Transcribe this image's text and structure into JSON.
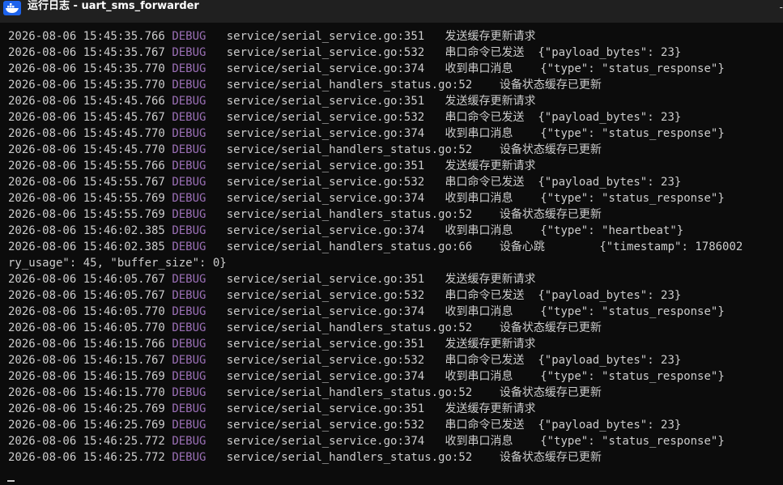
{
  "window": {
    "title": "运行日志 - uart_sms_forwarder",
    "app_icon": "whale-icon",
    "edge_glyph": "-"
  },
  "console": {
    "colors": {
      "background": "#0c0c0c",
      "text": "#cccccc",
      "level": "#9a6fb5"
    },
    "lines": [
      {
        "ts": "2026-08-06 15:45:35.766",
        "level": "DEBUG",
        "msg": "   service/serial_service.go:351   发送缓存更新请求"
      },
      {
        "ts": "2026-08-06 15:45:35.767",
        "level": "DEBUG",
        "msg": "   service/serial_service.go:532   串口命令已发送  {\"payload_bytes\": 23}"
      },
      {
        "ts": "2026-08-06 15:45:35.770",
        "level": "DEBUG",
        "msg": "   service/serial_service.go:374   收到串口消息    {\"type\": \"status_response\"}"
      },
      {
        "ts": "2026-08-06 15:45:35.770",
        "level": "DEBUG",
        "msg": "   service/serial_handlers_status.go:52    设备状态缓存已更新"
      },
      {
        "ts": "2026-08-06 15:45:45.766",
        "level": "DEBUG",
        "msg": "   service/serial_service.go:351   发送缓存更新请求"
      },
      {
        "ts": "2026-08-06 15:45:45.767",
        "level": "DEBUG",
        "msg": "   service/serial_service.go:532   串口命令已发送  {\"payload_bytes\": 23}"
      },
      {
        "ts": "2026-08-06 15:45:45.770",
        "level": "DEBUG",
        "msg": "   service/serial_service.go:374   收到串口消息    {\"type\": \"status_response\"}"
      },
      {
        "ts": "2026-08-06 15:45:45.770",
        "level": "DEBUG",
        "msg": "   service/serial_handlers_status.go:52    设备状态缓存已更新"
      },
      {
        "ts": "2026-08-06 15:45:55.766",
        "level": "DEBUG",
        "msg": "   service/serial_service.go:351   发送缓存更新请求"
      },
      {
        "ts": "2026-08-06 15:45:55.767",
        "level": "DEBUG",
        "msg": "   service/serial_service.go:532   串口命令已发送  {\"payload_bytes\": 23}"
      },
      {
        "ts": "2026-08-06 15:45:55.769",
        "level": "DEBUG",
        "msg": "   service/serial_service.go:374   收到串口消息    {\"type\": \"status_response\"}"
      },
      {
        "ts": "2026-08-06 15:45:55.769",
        "level": "DEBUG",
        "msg": "   service/serial_handlers_status.go:52    设备状态缓存已更新"
      },
      {
        "ts": "2026-08-06 15:46:02.385",
        "level": "DEBUG",
        "msg": "   service/serial_service.go:374   收到串口消息    {\"type\": \"heartbeat\"}"
      },
      {
        "ts": "2026-08-06 15:46:02.385",
        "level": "DEBUG",
        "msg": "   service/serial_handlers_status.go:66    设备心跳        {\"timestamp\": 1786002"
      },
      {
        "ts": "",
        "level": "",
        "msg": "ry_usage\": 45, \"buffer_size\": 0}"
      },
      {
        "ts": "2026-08-06 15:46:05.767",
        "level": "DEBUG",
        "msg": "   service/serial_service.go:351   发送缓存更新请求"
      },
      {
        "ts": "2026-08-06 15:46:05.767",
        "level": "DEBUG",
        "msg": "   service/serial_service.go:532   串口命令已发送  {\"payload_bytes\": 23}"
      },
      {
        "ts": "2026-08-06 15:46:05.770",
        "level": "DEBUG",
        "msg": "   service/serial_service.go:374   收到串口消息    {\"type\": \"status_response\"}"
      },
      {
        "ts": "2026-08-06 15:46:05.770",
        "level": "DEBUG",
        "msg": "   service/serial_handlers_status.go:52    设备状态缓存已更新"
      },
      {
        "ts": "2026-08-06 15:46:15.766",
        "level": "DEBUG",
        "msg": "   service/serial_service.go:351   发送缓存更新请求"
      },
      {
        "ts": "2026-08-06 15:46:15.767",
        "level": "DEBUG",
        "msg": "   service/serial_service.go:532   串口命令已发送  {\"payload_bytes\": 23}"
      },
      {
        "ts": "2026-08-06 15:46:15.769",
        "level": "DEBUG",
        "msg": "   service/serial_service.go:374   收到串口消息    {\"type\": \"status_response\"}"
      },
      {
        "ts": "2026-08-06 15:46:15.770",
        "level": "DEBUG",
        "msg": "   service/serial_handlers_status.go:52    设备状态缓存已更新"
      },
      {
        "ts": "2026-08-06 15:46:25.769",
        "level": "DEBUG",
        "msg": "   service/serial_service.go:351   发送缓存更新请求"
      },
      {
        "ts": "2026-08-06 15:46:25.769",
        "level": "DEBUG",
        "msg": "   service/serial_service.go:532   串口命令已发送  {\"payload_bytes\": 23}"
      },
      {
        "ts": "2026-08-06 15:46:25.772",
        "level": "DEBUG",
        "msg": "   service/serial_service.go:374   收到串口消息    {\"type\": \"status_response\"}"
      },
      {
        "ts": "2026-08-06 15:46:25.772",
        "level": "DEBUG",
        "msg": "   service/serial_handlers_status.go:52    设备状态缓存已更新"
      }
    ],
    "cursor": "_"
  }
}
